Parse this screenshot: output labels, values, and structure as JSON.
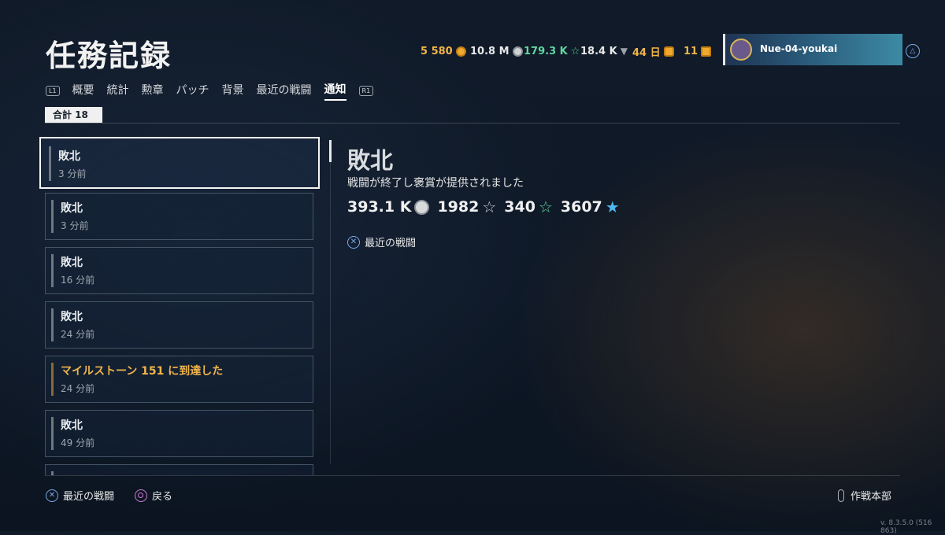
{
  "header": {
    "title": "任務記録"
  },
  "currencies": {
    "doubloons": "5 580",
    "credits": "10.8 M",
    "free_xp": "179.3 K",
    "commander_xp": "18.4 K",
    "premium_days": "44 日",
    "crates": "11"
  },
  "profile": {
    "name": "Nue-04-youkai"
  },
  "tabs": {
    "left_shoulder": "L1",
    "right_shoulder": "R1",
    "items": [
      "概要",
      "統計",
      "勲章",
      "パッチ",
      "背景",
      "最近の戦闘",
      "通知"
    ],
    "active": "通知"
  },
  "total": {
    "label": "合計 18"
  },
  "notifications": [
    {
      "title": "敗北",
      "time": "3 分前"
    },
    {
      "title": "敗北",
      "time": "3 分前"
    },
    {
      "title": "敗北",
      "time": "16 分前"
    },
    {
      "title": "敗北",
      "time": "24 分前"
    },
    {
      "title": "マイルストーン 151 に到達した",
      "time": "24 分前"
    },
    {
      "title": "敗北",
      "time": "49 分前"
    }
  ],
  "detail": {
    "title": "敗北",
    "subtitle": "戦闘が終了し褒賞が提供されました",
    "rewards": {
      "credits": "393.1 K",
      "xp": "1982",
      "free_xp": "340",
      "commander_xp": "3607"
    },
    "link": "最近の戦闘"
  },
  "footer": {
    "recent_battles": "最近の戦闘",
    "back": "戻る",
    "hq": "作戦本部"
  },
  "version": "v. 8.3.5.0 (516 863)",
  "colors": {
    "gold": "#f0b44a",
    "free_xp": "#5fd6a0",
    "commander_xp": "#4fb8f0",
    "accent_blue": "#7aa8e6"
  }
}
